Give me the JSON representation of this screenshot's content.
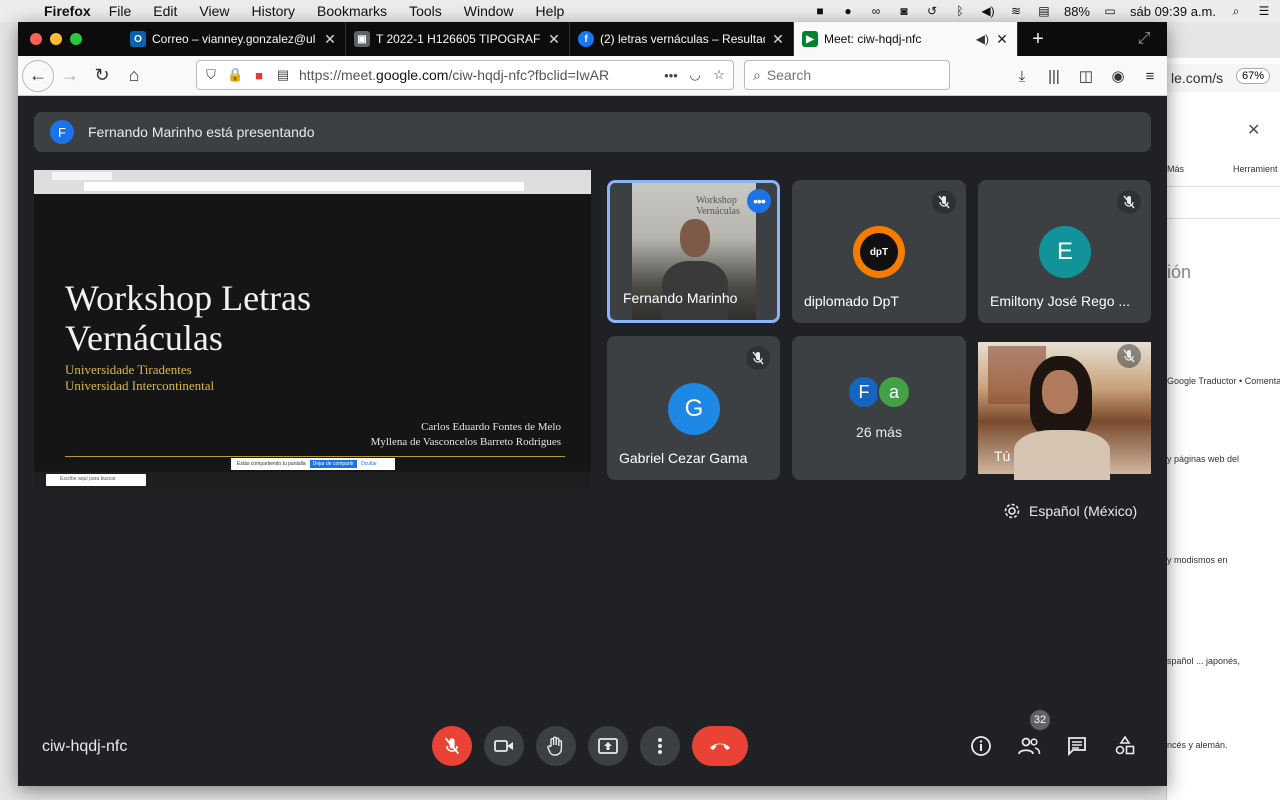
{
  "menubar": {
    "app": "Firefox",
    "items": [
      "File",
      "Edit",
      "View",
      "History",
      "Bookmarks",
      "Tools",
      "Window",
      "Help"
    ],
    "battery": "88%",
    "clock": "sáb 09:39 a.m."
  },
  "tabs": [
    {
      "label": "Correo – vianney.gonzalez@ul",
      "favicon": "outlook-icon",
      "color": "#0a64ad",
      "glyph": "O"
    },
    {
      "label": "T 2022-1 H126605 TIPOGRAFÍ",
      "favicon": "classroom-icon",
      "color": "#5f6368",
      "glyph": "▣"
    },
    {
      "label": "(2) letras vernáculas – Resultad",
      "favicon": "facebook-icon",
      "color": "#1877f2",
      "glyph": "f"
    },
    {
      "label": "Meet: ciw-hqdj-nfc",
      "favicon": "meet-icon",
      "color": "#00832d",
      "glyph": "▶",
      "active": true
    }
  ],
  "nav": {
    "url_prefix": "https://meet.",
    "url_domain": "google.com",
    "url_rest": "/ciw-hqdj-nfc?fbclid=IwAR",
    "search_placeholder": "Search"
  },
  "background_window": {
    "url": "le.com/s",
    "zoom": "67%",
    "tool_mas": "Más",
    "tool_herr": "Herramient",
    "heading": "ión",
    "line1": "Google Traductor  •  Comentar",
    "line2": "y páginas web del",
    "line3": "y modismos en",
    "line4": "spañol ... japonés,",
    "line5": "ncés y alemán."
  },
  "meet": {
    "presenter_initial": "F",
    "presenting_text": "Fernando Marinho está presentando",
    "slide": {
      "title_line1": "Workshop Letras",
      "title_line2": "Vernáculas",
      "sub1": "Universidade Tiradentes",
      "sub2": "Universidad Intercontinental",
      "author1": "Carlos Eduardo Fontes de Melo",
      "author2": "Myllena de Vasconcelos Barreto Rodrigues",
      "share_text": "Estás compartiendo tu pantalla",
      "share_btn1": "Dejar de compartir",
      "share_btn2": "Ocultar",
      "taskbar_search": "Escribe aquí para buscar"
    },
    "participants": [
      {
        "name": "Fernando Marinho",
        "kind": "video"
      },
      {
        "name": "diplomado DpT",
        "kind": "logo",
        "logo_text": "dpT"
      },
      {
        "name": "Emiltony José Rego ...",
        "initial": "E",
        "color": "#12939a"
      },
      {
        "name": "Gabriel Cezar Gama",
        "initial": "G",
        "color": "#1e88e5"
      },
      {
        "more_label": "26 más",
        "initials": [
          "F",
          "a"
        ],
        "colors": [
          "#1565c0",
          "#43a047"
        ]
      },
      {
        "name": "Tú",
        "kind": "video"
      }
    ],
    "language": "Español (México)",
    "meeting_code": "ciw-hqdj-nfc",
    "participant_count": "32"
  }
}
